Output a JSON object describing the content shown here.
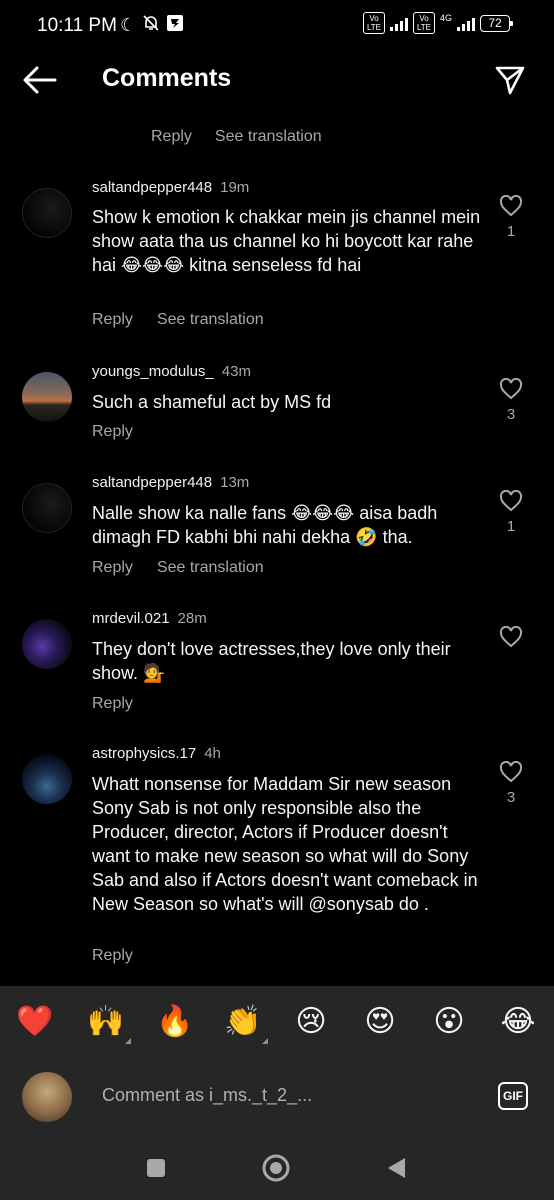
{
  "status_bar": {
    "time": "10:11 PM",
    "network": "4G",
    "volte_label": "Vo LTE",
    "battery": "72"
  },
  "header": {
    "title": "Comments"
  },
  "top_actions": {
    "reply": "Reply",
    "see_translation": "See translation"
  },
  "comments": [
    {
      "username": "saltandpepper448",
      "time": "19m",
      "text": "Show k emotion k chakkar mein jis channel mein show aata tha us channel ko hi boycott kar rahe hai 😂😂😂 kitna senseless fd hai",
      "likes": "1",
      "reply": "Reply",
      "see_translation": "See translation"
    },
    {
      "username": "youngs_modulus_",
      "time": "43m",
      "text": "Such a shameful act by MS fd",
      "likes": "3",
      "reply": "Reply"
    },
    {
      "username": "saltandpepper448",
      "time": "13m",
      "text": "Nalle show ka nalle fans 😂😂😂 aisa badh dimagh FD kabhi bhi nahi dekha 🤣 tha.",
      "likes": "1",
      "reply": "Reply",
      "see_translation": "See translation"
    },
    {
      "username": "mrdevil.021",
      "time": "28m",
      "text": "They don't love actresses,they love only their show. 💁",
      "reply": "Reply"
    },
    {
      "username": "astrophysics.17",
      "time": "4h",
      "text": "Whatt nonsense for Maddam Sir new season Sony Sab is not only responsible also the Producer, director, Actors if Producer doesn't want to make new season so what will do Sony Sab and also if Actors doesn't want comeback in New Season so what's will @sonysab do .",
      "likes": "3",
      "reply": "Reply"
    }
  ],
  "emoji_bar": [
    "❤️",
    "🙌",
    "🔥",
    "👏",
    "😢",
    "😍",
    "😮",
    "😂"
  ],
  "composer": {
    "placeholder": "Comment as i_ms._t_2_...",
    "gif_label": "GIF"
  },
  "colors": {
    "background": "#000000",
    "panel": "#262626",
    "secondary_text": "#a8a8a8"
  }
}
